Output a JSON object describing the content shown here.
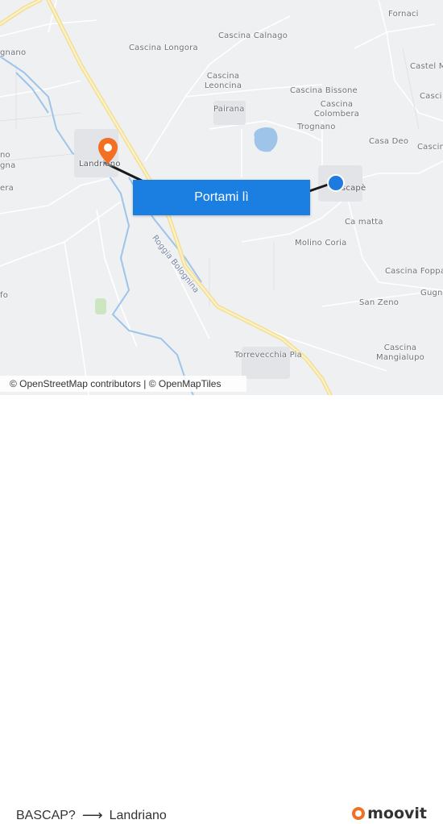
{
  "map": {
    "places": [
      {
        "name": "Fornaci"
      },
      {
        "name": "Cascina Calnago"
      },
      {
        "name": "Cascina Longora"
      },
      {
        "name": "Castel M"
      },
      {
        "name": "Cascina Leoncina"
      },
      {
        "name": "Cascina Bissone"
      },
      {
        "name": "Casci"
      },
      {
        "name": "Pairana"
      },
      {
        "name": "Cascina Colombera"
      },
      {
        "name": "Trognano"
      },
      {
        "name": "Casa Deo"
      },
      {
        "name": "Cascin"
      },
      {
        "name": "gnano"
      },
      {
        "name": "no"
      },
      {
        "name": "gna"
      },
      {
        "name": "era"
      },
      {
        "name": "Landriano"
      },
      {
        "name": "scapè"
      },
      {
        "name": "Ca matta"
      },
      {
        "name": "Molino Coria"
      },
      {
        "name": "Cascina Foppa"
      },
      {
        "name": "Gugn"
      },
      {
        "name": "San Zeno"
      },
      {
        "name": "fo"
      },
      {
        "name": "Torrevecchia Pia"
      },
      {
        "name": "Cascina Mangialupo"
      }
    ],
    "river_label": "Roggia Bolognina",
    "origin_marker": "origin-dot-icon",
    "destination_marker": "destination-pin-icon",
    "colors": {
      "origin": "#1f7ae0",
      "destination": "#f36f21",
      "route_line": "#1a1a1a",
      "water": "#9ec4ea",
      "major_road": "#f8e59a"
    }
  },
  "cta": {
    "label": "Portami lì"
  },
  "attribution": {
    "text": "© OpenStreetMap contributors | © OpenMapTiles"
  },
  "footer": {
    "from": "BASCAP?",
    "arrow": "⟶",
    "to": "Landriano",
    "brand": "moovit"
  }
}
